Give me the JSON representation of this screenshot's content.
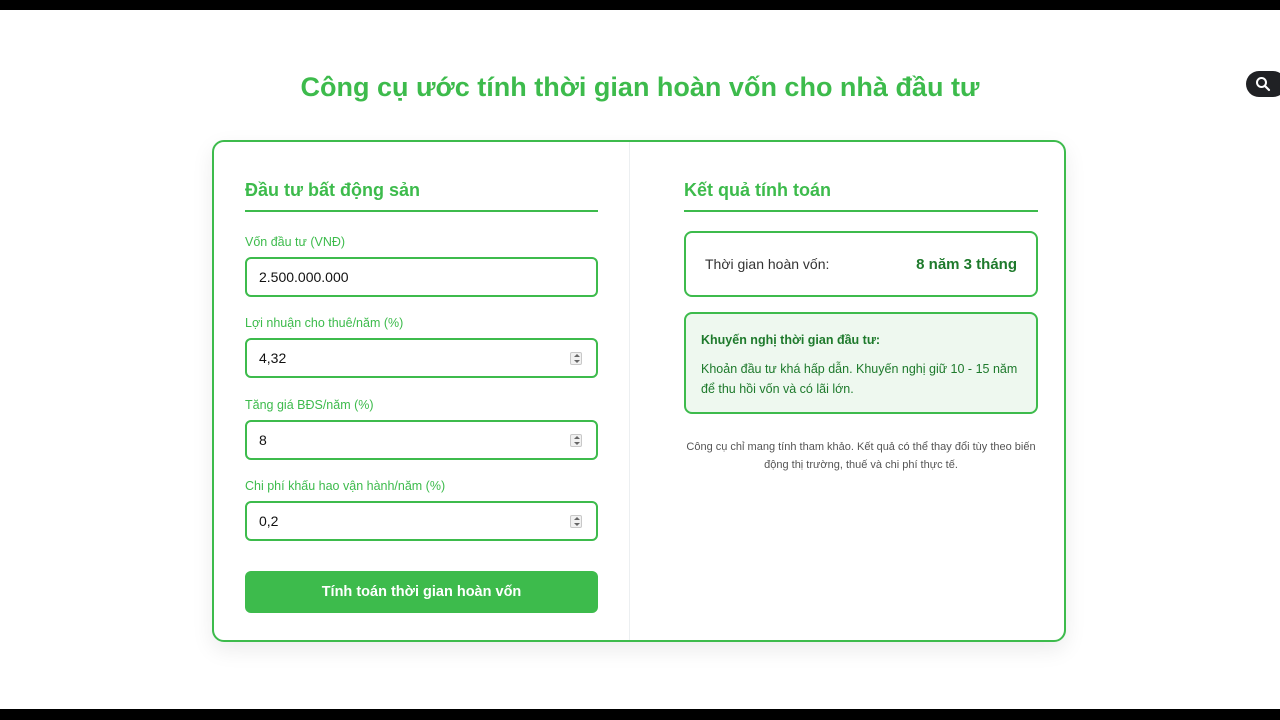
{
  "header": {
    "title": "Công cụ ước tính thời gian hoàn vốn cho nhà đầu tư"
  },
  "colors": {
    "accent": "#3dbb4c",
    "accent_dark": "#1e7a2c",
    "recommendation_bg": "#eef8ef"
  },
  "form": {
    "section_title": "Đầu tư bất động sản",
    "fields": [
      {
        "label": "Vốn đầu tư (VNĐ)",
        "value": "2.500.000.000"
      },
      {
        "label": "Lợi nhuận cho thuê/năm (%)",
        "value": "4,32"
      },
      {
        "label": "Tăng giá BĐS/năm (%)",
        "value": "8"
      },
      {
        "label": "Chi phí khấu hao vận hành/năm (%)",
        "value": "0,2"
      }
    ],
    "submit_label": "Tính toán thời gian hoàn vốn"
  },
  "results": {
    "section_title": "Kết quả tính toán",
    "payback_label": "Thời gian hoàn vốn:",
    "payback_value": "8 năm 3 tháng",
    "recommendation_title": "Khuyến nghị thời gian đầu tư:",
    "recommendation_text": "Khoản đầu tư khá hấp dẫn. Khuyến nghị giữ 10 - 15 năm để thu hồi vốn và có lãi lớn.",
    "disclaimer": "Công cụ chỉ mang tính tham khảo. Kết quả có thể thay đổi tùy theo biến động thị trường, thuế và chi phí thực tế."
  },
  "icons": {
    "search": "search-icon"
  }
}
